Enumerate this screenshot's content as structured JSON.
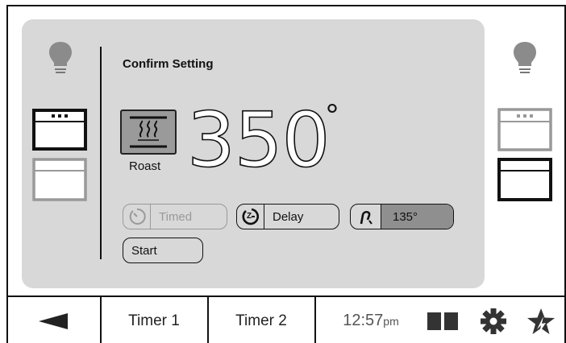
{
  "panel": {
    "title": "Confirm Setting",
    "mode_label": "Roast",
    "temperature": "350",
    "degree_symbol": "°"
  },
  "buttons": {
    "timed": "Timed",
    "delay": "Delay",
    "probe": "135°",
    "start": "Start"
  },
  "bottom_bar": {
    "timer1": "Timer 1",
    "timer2": "Timer 2",
    "clock_time": "12:57",
    "clock_suffix": "pm"
  },
  "icons": {
    "back": "back-arrow-icon",
    "split": "split-view-icon",
    "settings": "gear-icon",
    "favorite": "star-icon",
    "light": "light-bulb-icon",
    "oven": "oven-icon"
  },
  "colors": {
    "panel_bg": "#d8d8d8",
    "selected_oven": "#111111",
    "unselected_oven": "#999999"
  }
}
